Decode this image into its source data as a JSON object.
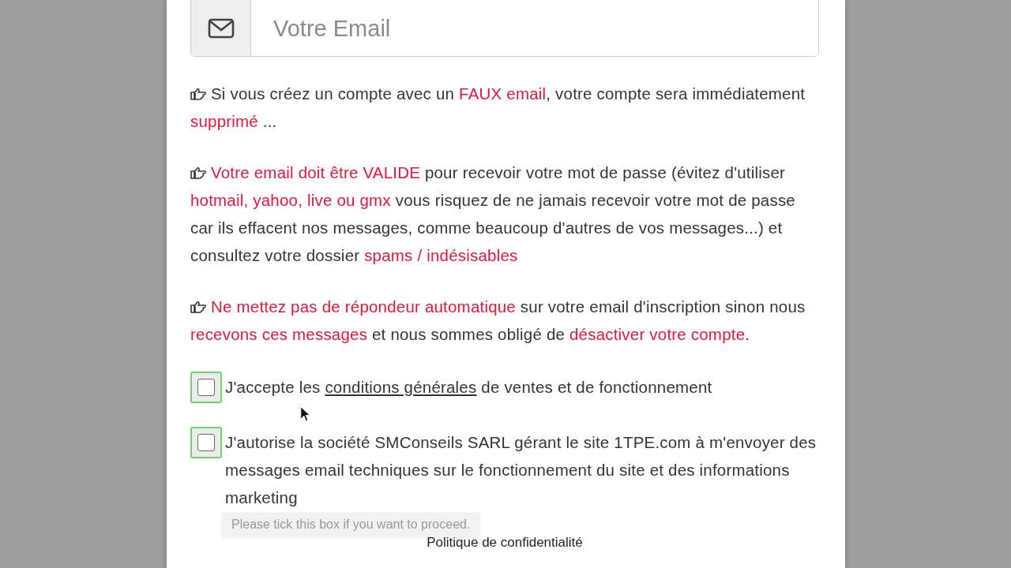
{
  "email_field": {
    "placeholder": "Votre Email"
  },
  "notices": [
    {
      "segments": [
        {
          "kind": "text",
          "text": "Si vous créez un compte avec un "
        },
        {
          "kind": "alert",
          "text": "FAUX email"
        },
        {
          "kind": "text",
          "text": ", votre compte sera immédiatement "
        },
        {
          "kind": "alert",
          "text": "supprimé"
        },
        {
          "kind": "text",
          "text": " ..."
        }
      ]
    },
    {
      "segments": [
        {
          "kind": "alert",
          "text": "Votre email doit être VALIDE"
        },
        {
          "kind": "text",
          "text": " pour recevoir votre mot de passe (évitez d'utiliser "
        },
        {
          "kind": "alert",
          "text": "hotmail, yahoo, live ou gmx"
        },
        {
          "kind": "text",
          "text": " vous risquez de ne jamais recevoir votre mot de passe car ils effacent nos messages, comme beaucoup d'autres de vos messages...) et consultez votre dossier "
        },
        {
          "kind": "alert",
          "text": "spams / indésisables"
        }
      ]
    },
    {
      "segments": [
        {
          "kind": "alert",
          "text": "Ne mettez pas de répondeur automatique"
        },
        {
          "kind": "text",
          "text": " sur votre email d'inscription sinon nous "
        },
        {
          "kind": "alert",
          "text": "recevons ces messages"
        },
        {
          "kind": "text",
          "text": " et nous sommes obligé de "
        },
        {
          "kind": "alert",
          "text": "désactiver votre compte"
        },
        {
          "kind": "text",
          "text": "."
        }
      ]
    }
  ],
  "agreements": [
    {
      "checked": false,
      "segments": [
        {
          "kind": "text",
          "text": "J'accepte les "
        },
        {
          "kind": "link",
          "text": "conditions générales"
        },
        {
          "kind": "text",
          "text": " de ventes et de fonctionnement"
        }
      ]
    },
    {
      "checked": false,
      "segments": [
        {
          "kind": "text",
          "text": "J'autorise la société SMConseils SARL gérant le site 1TPE.com à m'envoyer des messages email techniques sur le fonctionnement du site et des informations marketing"
        }
      ],
      "tooltip": "Please tick this box if you want to proceed."
    }
  ],
  "footer_link": "Politique de confidentialité"
}
